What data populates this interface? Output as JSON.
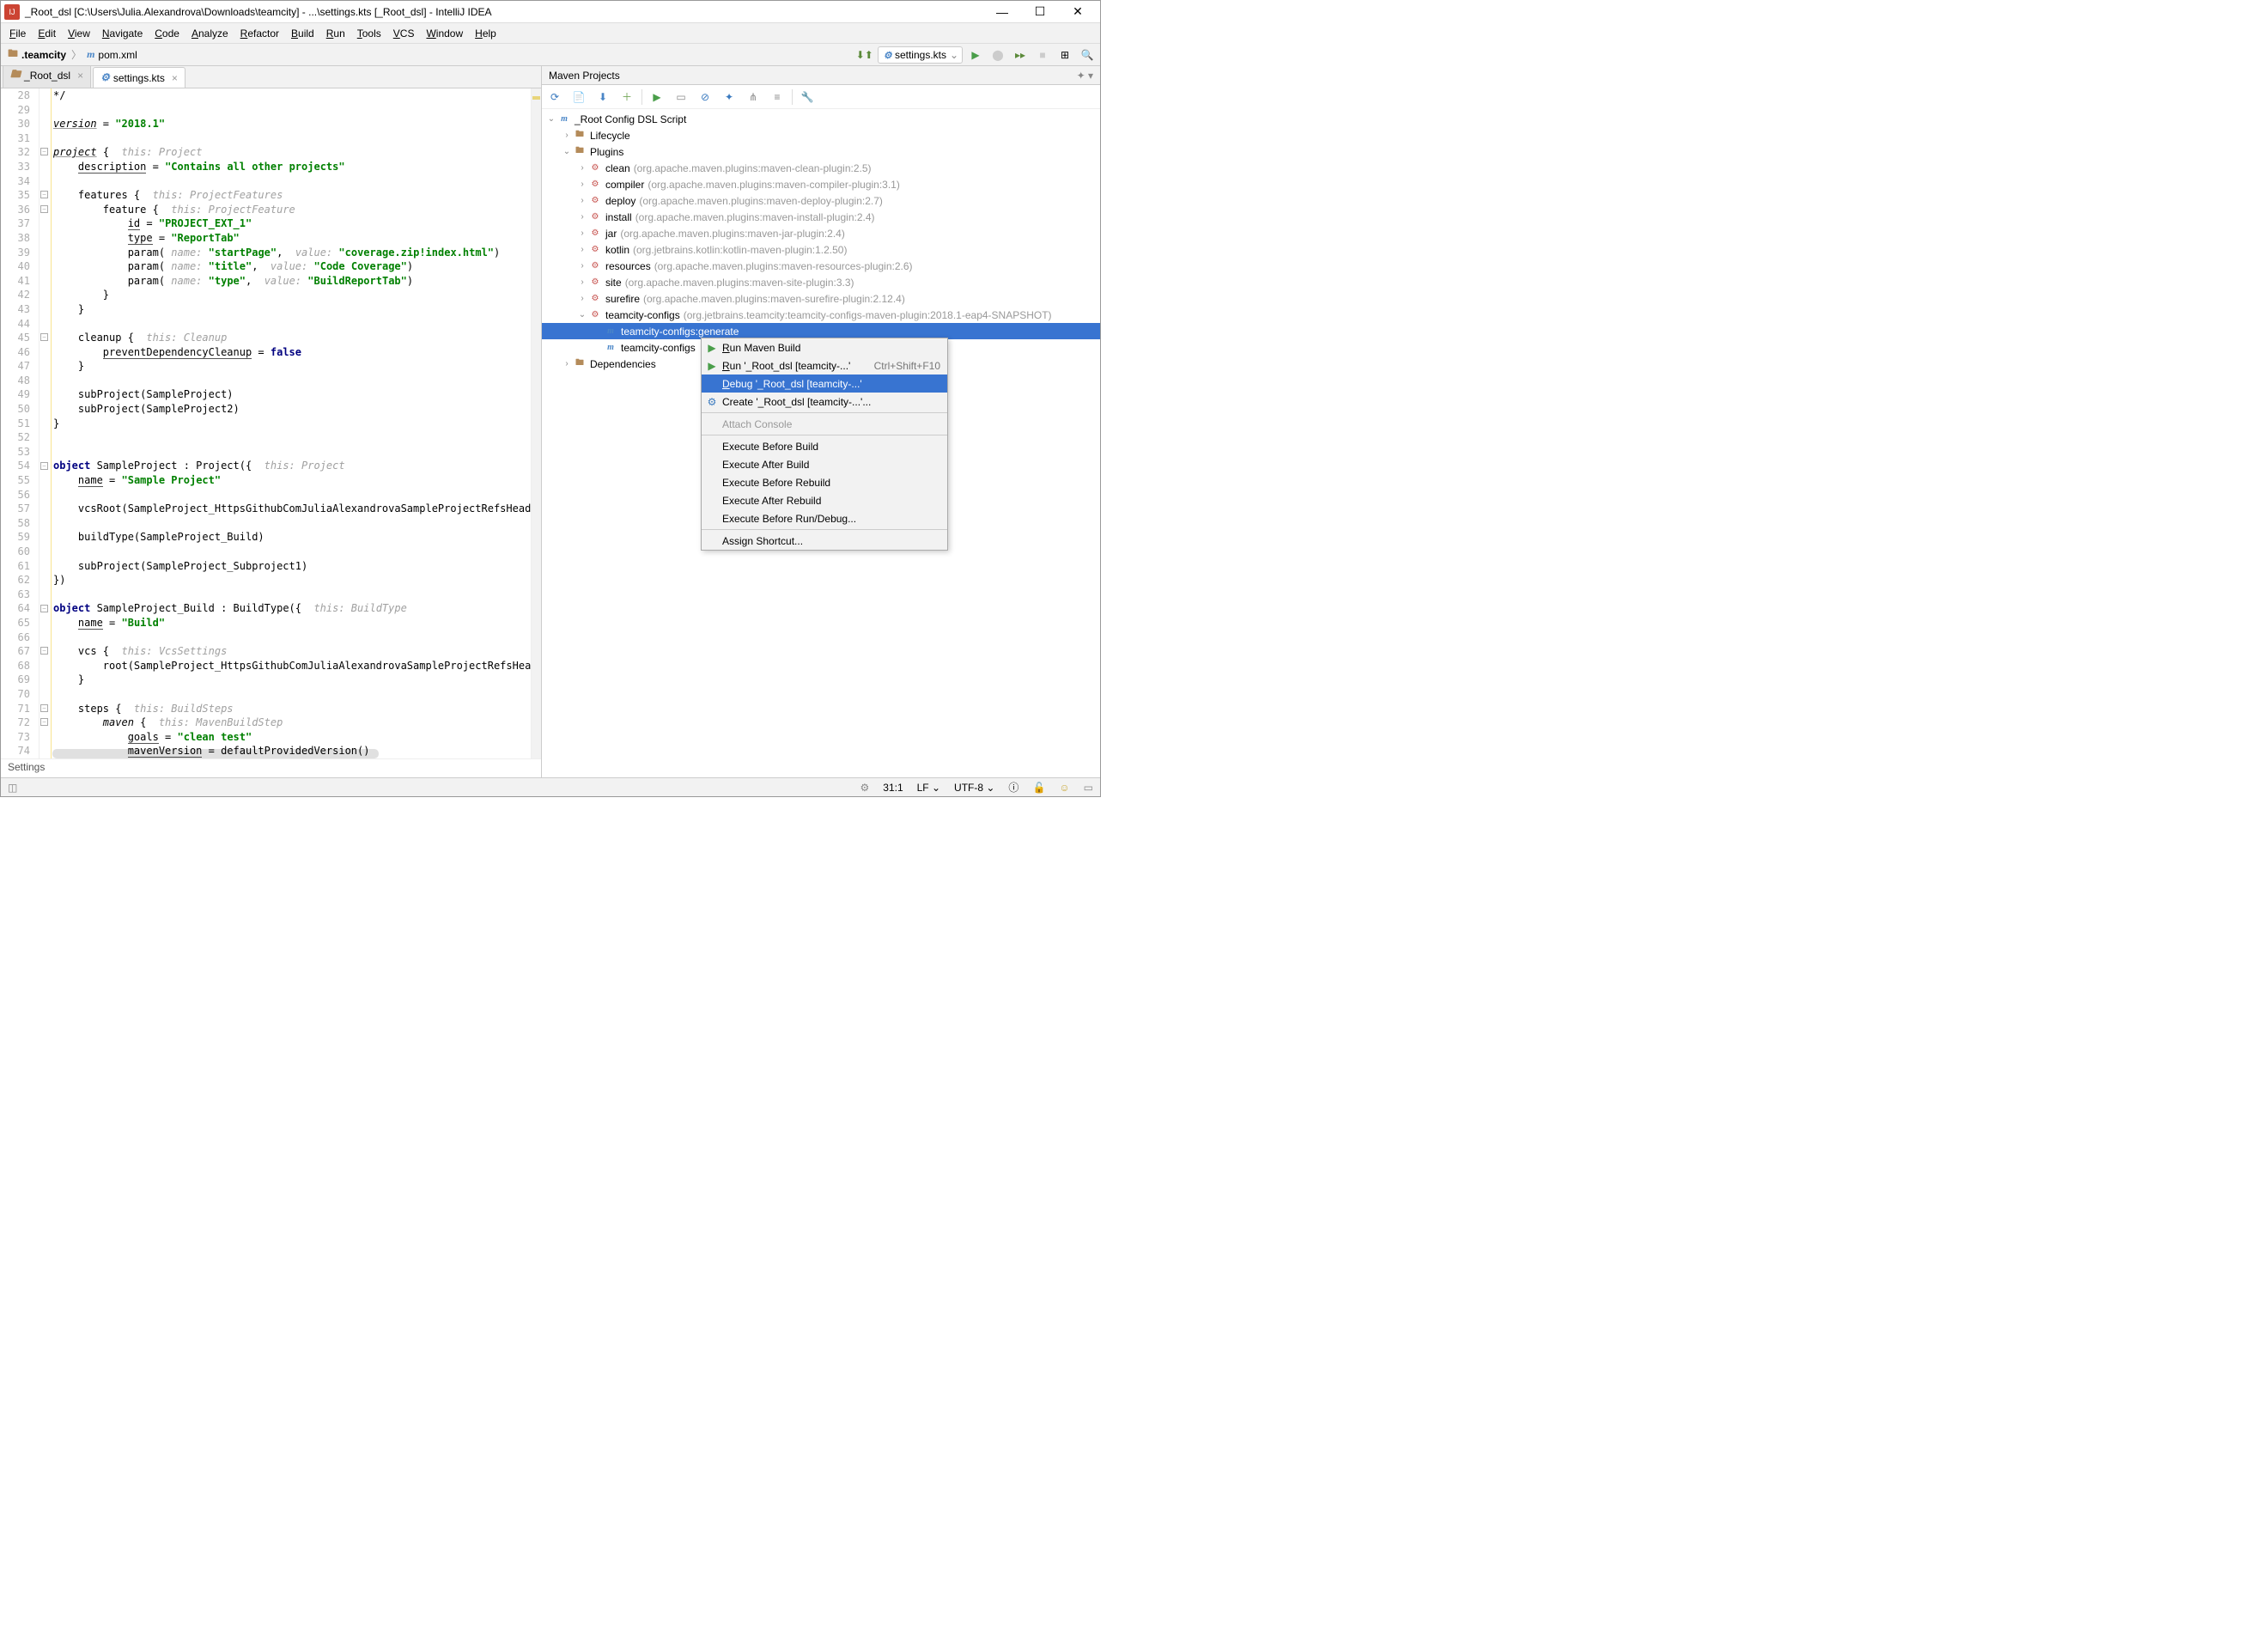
{
  "titlebar": {
    "text": "_Root_dsl [C:\\Users\\Julia.Alexandrova\\Downloads\\teamcity] - ...\\settings.kts [_Root_dsl] - IntelliJ IDEA"
  },
  "menubar": [
    "File",
    "Edit",
    "View",
    "Navigate",
    "Code",
    "Analyze",
    "Refactor",
    "Build",
    "Run",
    "Tools",
    "VCS",
    "Window",
    "Help"
  ],
  "breadcrumbs": {
    "c1": ".teamcity",
    "c2": "pom.xml"
  },
  "run_config": "settings.kts",
  "editor_tabs": [
    {
      "label": "_Root_dsl",
      "active": false
    },
    {
      "label": "settings.kts",
      "active": true
    }
  ],
  "gutter_start": 28,
  "gutter_end": 74,
  "crumb_footer": "Settings",
  "code_lines": [
    {
      "n": 28,
      "t": "*/",
      "cls": "cm"
    },
    {
      "n": 29,
      "t": ""
    },
    {
      "n": 30,
      "html": "<span class='u'><span style='font-style:italic'>version</span></span> = <span class='str'>\"2018.1\"</span>"
    },
    {
      "n": 31,
      "t": "",
      "hl": true
    },
    {
      "n": 32,
      "html": "<span class='u' style='font-style:italic'>project</span> <span class='kw'></span>{  <span class='hint'>this: Project</span>",
      "fold": "-"
    },
    {
      "n": 33,
      "html": "    <span class='u2'>description</span> = <span class='str'>\"Contains all other projects\"</span>"
    },
    {
      "n": 34,
      "t": ""
    },
    {
      "n": 35,
      "html": "    features {  <span class='hint'>this: ProjectFeatures</span>",
      "fold": "-"
    },
    {
      "n": 36,
      "html": "        feature {  <span class='hint'>this: ProjectFeature</span>",
      "fold": "-"
    },
    {
      "n": 37,
      "html": "            <span class='u2'>id</span> = <span class='str'>\"PROJECT_EXT_1\"</span>"
    },
    {
      "n": 38,
      "html": "            <span class='u2'>type</span> = <span class='str'>\"ReportTab\"</span>"
    },
    {
      "n": 39,
      "html": "            param( <span class='hint'>name:</span> <span class='str'>\"startPage\"</span>,  <span class='hint'>value:</span> <span class='str'>\"coverage.zip!index.html\"</span>)"
    },
    {
      "n": 40,
      "html": "            param( <span class='hint'>name:</span> <span class='str'>\"title\"</span>,  <span class='hint'>value:</span> <span class='str'>\"Code Coverage\"</span>)"
    },
    {
      "n": 41,
      "html": "            param( <span class='hint'>name:</span> <span class='str'>\"type\"</span>,  <span class='hint'>value:</span> <span class='str'>\"BuildReportTab\"</span>)"
    },
    {
      "n": 42,
      "t": "        }"
    },
    {
      "n": 43,
      "t": "    }"
    },
    {
      "n": 44,
      "t": ""
    },
    {
      "n": 45,
      "html": "    cleanup {  <span class='hint'>this: Cleanup</span>",
      "fold": "-"
    },
    {
      "n": 46,
      "html": "        <span class='u2'>preventDependencyCleanup</span> = <span class='kw'>false</span>"
    },
    {
      "n": 47,
      "t": "    }"
    },
    {
      "n": 48,
      "t": ""
    },
    {
      "n": 49,
      "t": "    subProject(SampleProject)"
    },
    {
      "n": 50,
      "t": "    subProject(SampleProject2)"
    },
    {
      "n": 51,
      "t": "}"
    },
    {
      "n": 52,
      "t": ""
    },
    {
      "n": 53,
      "t": ""
    },
    {
      "n": 54,
      "html": "<span class='kw'>object</span> SampleProject : Project({  <span class='hint'>this: Project</span>",
      "fold": "-"
    },
    {
      "n": 55,
      "html": "    <span class='u2'>name</span> = <span class='str'>\"Sample Project\"</span>"
    },
    {
      "n": 56,
      "t": ""
    },
    {
      "n": 57,
      "t": "    vcsRoot(SampleProject_HttpsGithubComJuliaAlexandrovaSampleProjectRefsHeadsMaste"
    },
    {
      "n": 58,
      "t": ""
    },
    {
      "n": 59,
      "t": "    buildType(SampleProject_Build)"
    },
    {
      "n": 60,
      "t": ""
    },
    {
      "n": 61,
      "t": "    subProject(SampleProject_Subproject1)"
    },
    {
      "n": 62,
      "t": "})"
    },
    {
      "n": 63,
      "t": ""
    },
    {
      "n": 64,
      "html": "<span class='kw'>object</span> SampleProject_Build : BuildType({  <span class='hint'>this: BuildType</span>",
      "fold": "-"
    },
    {
      "n": 65,
      "html": "    <span class='u2'>name</span> = <span class='str'>\"Build\"</span>"
    },
    {
      "n": 66,
      "t": ""
    },
    {
      "n": 67,
      "html": "    vcs {  <span class='hint'>this: VcsSettings</span>",
      "fold": "-"
    },
    {
      "n": 68,
      "t": "        root(SampleProject_HttpsGithubComJuliaAlexandrovaSampleProjectRefsHeadsMast"
    },
    {
      "n": 69,
      "t": "    }"
    },
    {
      "n": 70,
      "t": ""
    },
    {
      "n": 71,
      "html": "    steps {  <span class='hint'>this: BuildSteps</span>",
      "fold": "-"
    },
    {
      "n": 72,
      "html": "        <span style='font-style:italic'>maven</span> {  <span class='hint'>this: MavenBuildStep</span>",
      "fold": "-"
    },
    {
      "n": 73,
      "html": "            <span class='u2'>goals</span> = <span class='str'>\"clean test\"</span>"
    },
    {
      "n": 74,
      "html": "            <span class='u2'>mavenVersion</span> = defaultProvidedVersion()"
    }
  ],
  "maven_panel": {
    "title": "Maven Projects",
    "root": "_Root Config DSL Script",
    "lifecycle": "Lifecycle",
    "plugins": "Plugins",
    "plugin_items": [
      {
        "name": "clean",
        "desc": "(org.apache.maven.plugins:maven-clean-plugin:2.5)"
      },
      {
        "name": "compiler",
        "desc": "(org.apache.maven.plugins:maven-compiler-plugin:3.1)"
      },
      {
        "name": "deploy",
        "desc": "(org.apache.maven.plugins:maven-deploy-plugin:2.7)"
      },
      {
        "name": "install",
        "desc": "(org.apache.maven.plugins:maven-install-plugin:2.4)"
      },
      {
        "name": "jar",
        "desc": "(org.apache.maven.plugins:maven-jar-plugin:2.4)"
      },
      {
        "name": "kotlin",
        "desc": "(org.jetbrains.kotlin:kotlin-maven-plugin:1.2.50)"
      },
      {
        "name": "resources",
        "desc": "(org.apache.maven.plugins:maven-resources-plugin:2.6)"
      },
      {
        "name": "site",
        "desc": "(org.apache.maven.plugins:maven-site-plugin:3.3)"
      },
      {
        "name": "surefire",
        "desc": "(org.apache.maven.plugins:maven-surefire-plugin:2.12.4)"
      }
    ],
    "tc_plugin": {
      "name": "teamcity-configs",
      "desc": "(org.jetbrains.teamcity:teamcity-configs-maven-plugin:2018.1-eap4-SNAPSHOT)"
    },
    "goals": [
      "teamcity-configs:generate",
      "teamcity-configs"
    ],
    "deps": "Dependencies"
  },
  "context_menu": {
    "items": [
      {
        "label": "Run Maven Build",
        "u": 0,
        "icon": "run"
      },
      {
        "label": "Run '_Root_dsl [teamcity-...'",
        "u": 0,
        "icon": "run",
        "shortcut": "Ctrl+Shift+F10"
      },
      {
        "label": "Debug '_Root_dsl [teamcity-...'",
        "u": 0,
        "sel": true
      },
      {
        "label": "Create '_Root_dsl [teamcity-...'...",
        "icon": "gear"
      },
      {
        "sep": true
      },
      {
        "label": "Attach Console",
        "dis": true
      },
      {
        "sep": true
      },
      {
        "label": "Execute Before Build"
      },
      {
        "label": "Execute After Build"
      },
      {
        "label": "Execute Before Rebuild"
      },
      {
        "label": "Execute After Rebuild"
      },
      {
        "label": "Execute Before Run/Debug..."
      },
      {
        "sep": true
      },
      {
        "label": "Assign Shortcut..."
      }
    ]
  },
  "statusbar": {
    "pos": "31:1",
    "le": "LF",
    "enc": "UTF-8",
    "ctx": "⎆"
  }
}
